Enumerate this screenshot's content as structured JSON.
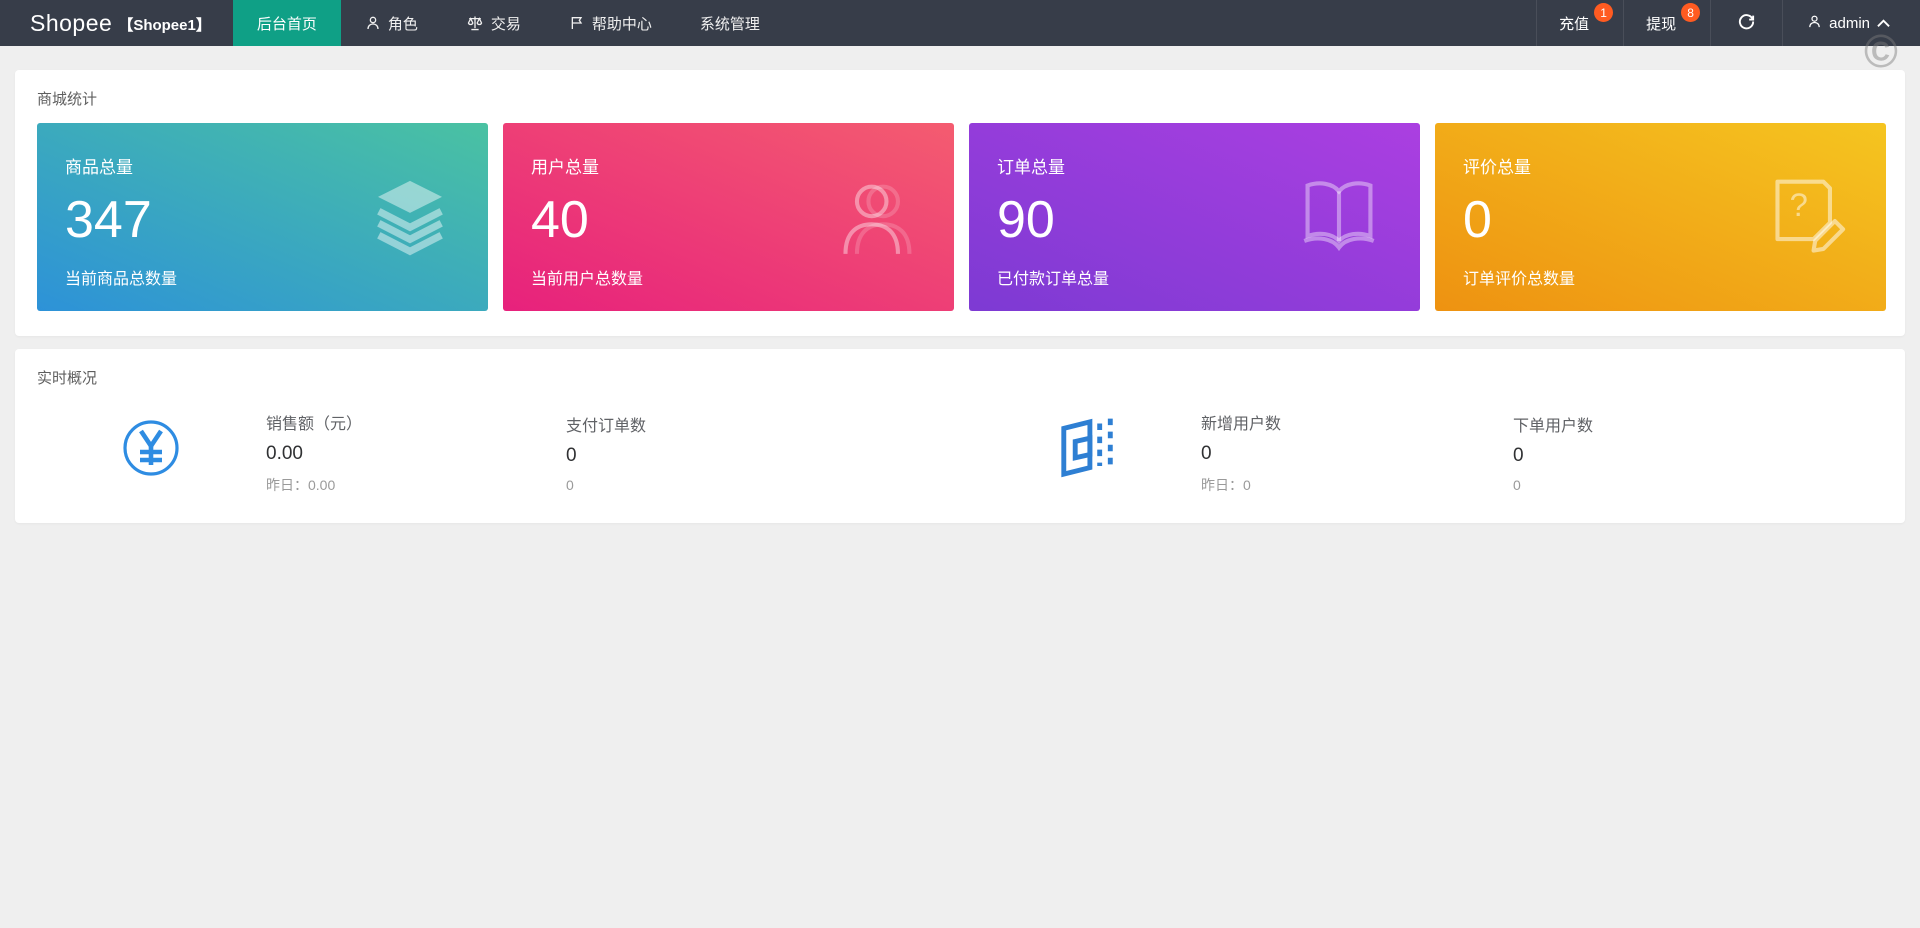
{
  "navbar": {
    "logo": {
      "brand": "Shopee",
      "sub": "【Shopee1】"
    },
    "menu": [
      {
        "label": "后台首页",
        "icon": null,
        "active": true
      },
      {
        "label": "角色",
        "icon": "user",
        "active": false
      },
      {
        "label": "交易",
        "icon": "scale",
        "active": false
      },
      {
        "label": "帮助中心",
        "icon": "flag",
        "active": false
      },
      {
        "label": "系统管理",
        "icon": null,
        "active": false
      }
    ],
    "actions": [
      {
        "label": "充值",
        "badge": "1"
      },
      {
        "label": "提现",
        "badge": "8"
      }
    ],
    "user": {
      "name": "admin"
    }
  },
  "watermark": "©",
  "colors": {
    "navbar_bg": "#373d49",
    "active_tab": "#0fa086",
    "badge": "#ff5b21",
    "icon_blue": "#2e8ce2",
    "page_bg": "#efefef"
  },
  "stats_panel": {
    "title": "商城统计",
    "cards": [
      {
        "label": "商品总量",
        "value": "347",
        "desc": "当前商品总数量",
        "icon": "layers",
        "gradient": [
          "#2d92d8",
          "#4ac2a2"
        ]
      },
      {
        "label": "用户总量",
        "value": "40",
        "desc": "当前用户总数量",
        "icon": "person",
        "gradient": [
          "#e7217c",
          "#f45c70"
        ]
      },
      {
        "label": "订单总量",
        "value": "90",
        "desc": "已付款订单总量",
        "icon": "book",
        "gradient": [
          "#7d3ad3",
          "#ab3fe1"
        ]
      },
      {
        "label": "评价总量",
        "value": "0",
        "desc": "订单评价总数量",
        "icon": "question-doc",
        "gradient": [
          "#ee9211",
          "#f5c520"
        ]
      }
    ]
  },
  "realtime_panel": {
    "title": "实时概况",
    "stats": [
      {
        "label": "销售额（元）",
        "value": "0.00",
        "sub": "昨日：0.00"
      },
      {
        "label": "支付订单数",
        "value": "0",
        "sub": "0"
      },
      {
        "label": "新增用户数",
        "value": "0",
        "sub": "昨日：0"
      },
      {
        "label": "下单用户数",
        "value": "0",
        "sub": "0"
      }
    ]
  }
}
